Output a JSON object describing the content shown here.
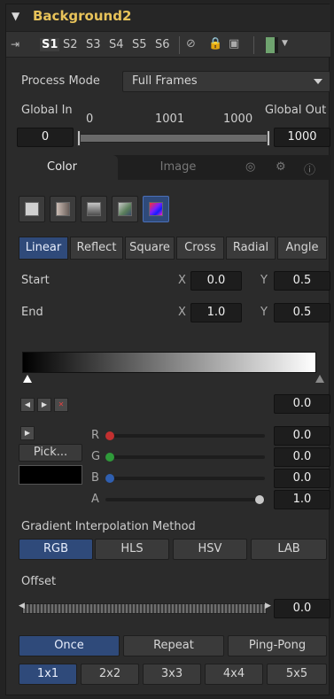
{
  "header": {
    "title": "Background2"
  },
  "versions": [
    "S1",
    "S2",
    "S3",
    "S4",
    "S5",
    "S6"
  ],
  "process_mode": {
    "label": "Process Mode",
    "value": "Full Frames"
  },
  "global_in": {
    "label": "Global In",
    "value": "0",
    "range_min": "0",
    "range_mid": "1001",
    "range_max": "1000"
  },
  "global_out": {
    "label": "Global Out",
    "value": "1000"
  },
  "tabs": {
    "color": "Color",
    "image": "Image"
  },
  "gradient_types": [
    "Linear",
    "Reflect",
    "Square",
    "Cross",
    "Radial",
    "Angle"
  ],
  "start": {
    "label": "Start",
    "x_label": "X",
    "x": "0.0",
    "y_label": "Y",
    "y": "0.5"
  },
  "end": {
    "label": "End",
    "x_label": "X",
    "x": "1.0",
    "y_label": "Y",
    "y": "0.5"
  },
  "key_position": "0.0",
  "pick_label": "Pick...",
  "channels": [
    {
      "name": "R",
      "value": "0.0",
      "color": "#c23030"
    },
    {
      "name": "G",
      "value": "0.0",
      "color": "#2f9a3a"
    },
    {
      "name": "B",
      "value": "0.0",
      "color": "#2f5fb0"
    },
    {
      "name": "A",
      "value": "1.0",
      "color": "#c8c8c8"
    }
  ],
  "interp": {
    "label": "Gradient Interpolation Method",
    "options": [
      "RGB",
      "HLS",
      "HSV",
      "LAB"
    ]
  },
  "offset": {
    "label": "Offset",
    "value": "0.0"
  },
  "repeat": [
    "Once",
    "Repeat",
    "Ping-Pong"
  ],
  "supersample": [
    "1x1",
    "2x2",
    "3x3",
    "4x4",
    "5x5"
  ]
}
